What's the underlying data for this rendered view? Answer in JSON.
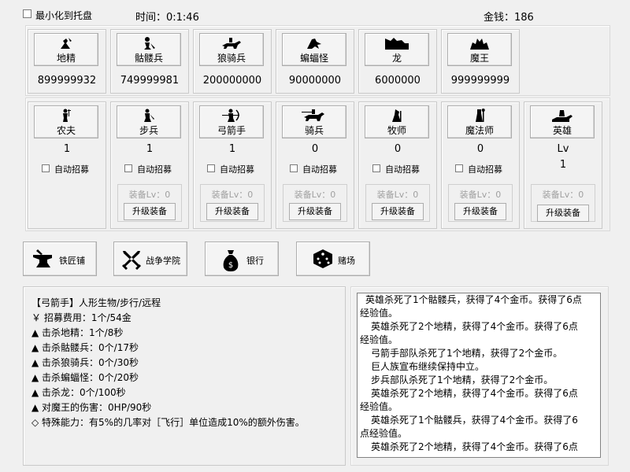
{
  "top": {
    "minimize_label": "最小化到托盘",
    "time_label": "时间：0:1:46",
    "money_label": "金钱：186"
  },
  "enemies": [
    {
      "name": "地精",
      "count": "899999932",
      "icon": "goblin-icon"
    },
    {
      "name": "骷髅兵",
      "count": "749999981",
      "icon": "skeleton-icon"
    },
    {
      "name": "狼骑兵",
      "count": "200000000",
      "icon": "wolf-rider-icon"
    },
    {
      "name": "蝙蝠怪",
      "count": "90000000",
      "icon": "bat-icon"
    },
    {
      "name": "龙",
      "count": "6000000",
      "icon": "dragon-icon"
    },
    {
      "name": "魔王",
      "count": "999999999",
      "icon": "demon-king-icon"
    }
  ],
  "units": [
    {
      "name": "农夫",
      "count": "1",
      "auto": "自动招募",
      "icon": "farmer-icon"
    },
    {
      "name": "步兵",
      "count": "1",
      "auto": "自动招募",
      "equip": "装备Lv：0",
      "upgrade": "升级装备",
      "icon": "infantry-icon"
    },
    {
      "name": "弓箭手",
      "count": "1",
      "auto": "自动招募",
      "equip": "装备Lv：0",
      "upgrade": "升级装备",
      "icon": "archer-icon"
    },
    {
      "name": "骑兵",
      "count": "0",
      "auto": "自动招募",
      "equip": "装备Lv：0",
      "upgrade": "升级装备",
      "icon": "cavalry-icon"
    },
    {
      "name": "牧师",
      "count": "0",
      "auto": "自动招募",
      "equip": "装备Lv：0",
      "upgrade": "升级装备",
      "icon": "priest-icon"
    },
    {
      "name": "魔法师",
      "count": "0",
      "auto": "自动招募",
      "equip": "装备Lv：0",
      "upgrade": "升级装备",
      "icon": "mage-icon"
    }
  ],
  "hero": {
    "name": "英雄",
    "lv_label": "Lv",
    "lv": "1",
    "equip": "装备Lv：0",
    "upgrade": "升级装备",
    "icon": "hero-icon"
  },
  "buildings": [
    {
      "label": "铁匠铺",
      "icon": "anvil-icon"
    },
    {
      "label": "战争学院",
      "icon": "crossed-swords-icon"
    },
    {
      "label": "银行",
      "icon": "money-bag-icon"
    },
    {
      "label": "赌场",
      "icon": "dice-icon"
    }
  ],
  "info": {
    "lines": [
      "【弓箭手】人形生物/步行/远程",
      "￥ 招募费用：1个/54金",
      "▲ 击杀地精：1个/8秒",
      "▲ 击杀骷髅兵：0个/17秒",
      "▲ 击杀狼骑兵：0个/30秒",
      "▲ 击杀蝙蝠怪：0个/20秒",
      "▲ 击杀龙：0个/100秒",
      "▲ 对魔王的伤害：0HP/90秒",
      "◇ 特殊能力：有5%的几率对［飞行］单位造成10%的额外伤害。"
    ]
  },
  "log": {
    "lines": [
      "英雄杀死了1个骷髅兵，获得了4个金币。获得了6点",
      "经验值。",
      "英雄杀死了2个地精，获得了4个金币。获得了6点",
      "经验值。",
      "弓箭手部队杀死了1个地精，获得了2个金币。",
      "巨人族宣布继续保持中立。",
      "步兵部队杀死了1个地精，获得了2个金币。",
      "英雄杀死了2个地精，获得了4个金币。获得了6点",
      "经验值。",
      "英雄杀死了1个骷髅兵，获得了4个金币。获得了6",
      "点经验值。",
      "英雄杀死了2个地精，获得了4个金币。获得了6点"
    ]
  }
}
